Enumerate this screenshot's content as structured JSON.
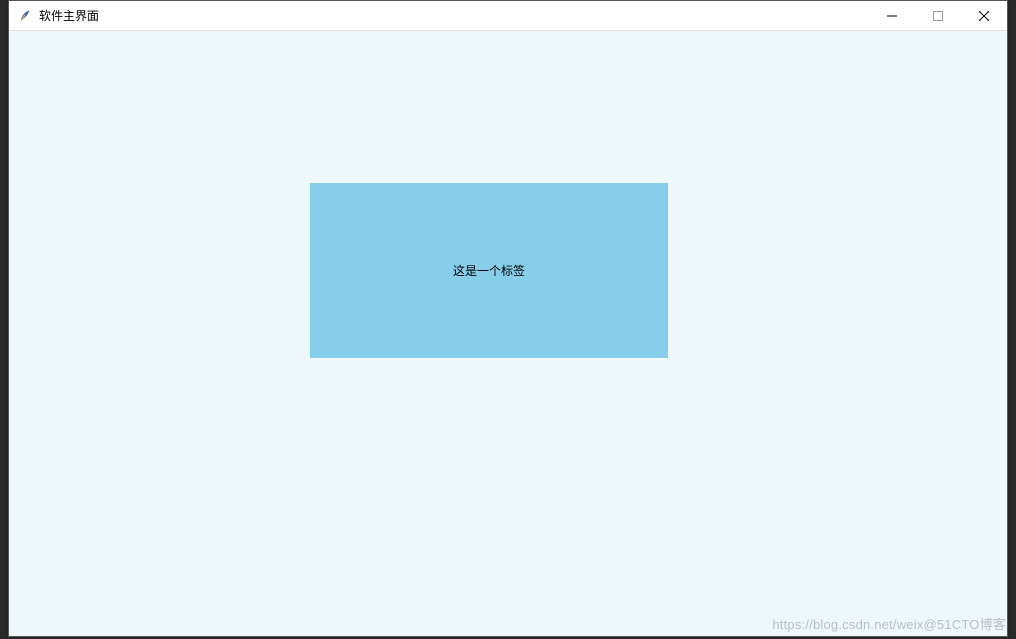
{
  "window": {
    "title": "软件主界面",
    "icon_name": "feather-icon"
  },
  "titlebar": {
    "minimize_label": "—",
    "maximize_label": "□",
    "close_label": "✕"
  },
  "content": {
    "label_text": "这是一个标签"
  },
  "colors": {
    "client_bg": "#eef7fc",
    "label_bg": "#87ceeb"
  },
  "watermark": "https://blog.csdn.net/weix@51CTO博客"
}
